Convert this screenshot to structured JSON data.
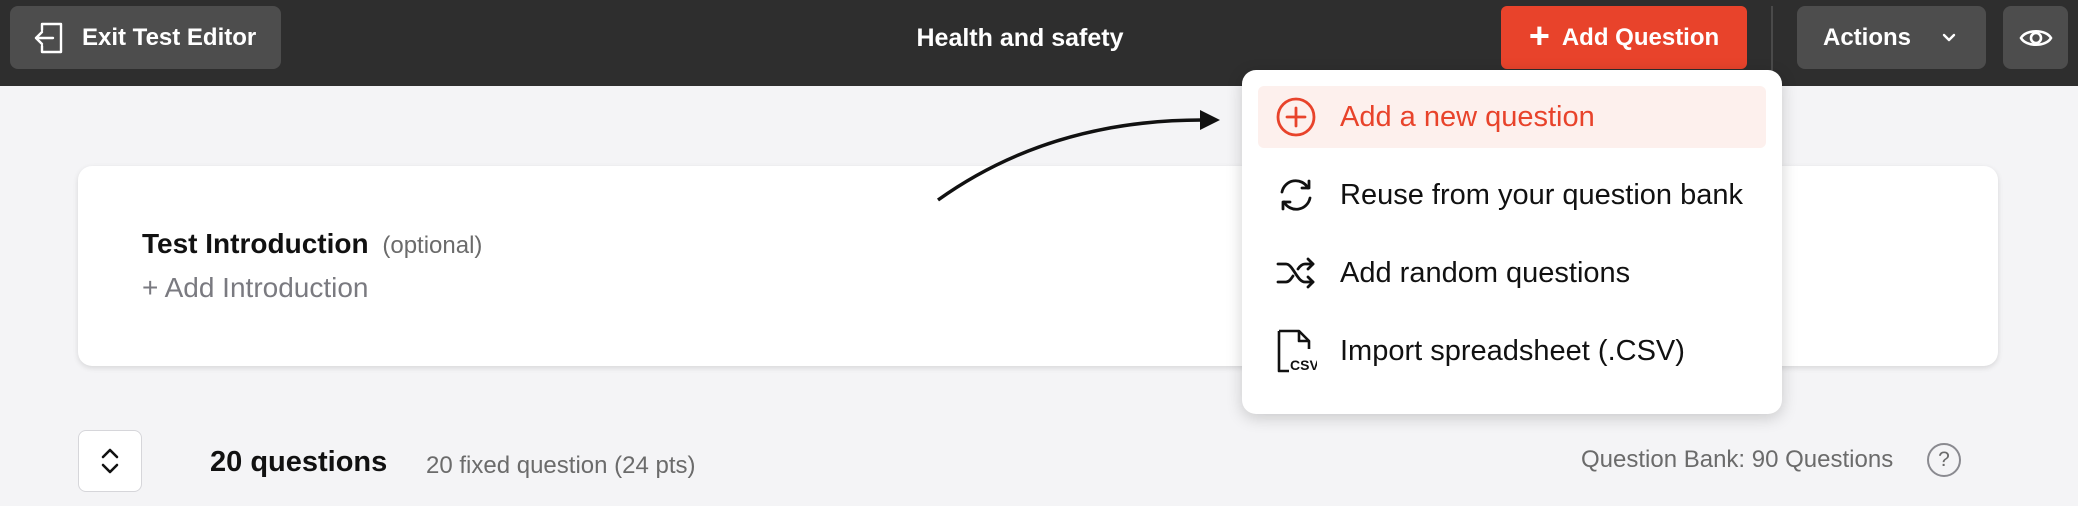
{
  "header": {
    "exit_label": "Exit Test Editor",
    "title": "Health and safety",
    "add_question_label": "Add Question",
    "actions_label": "Actions"
  },
  "icons": {
    "exit": "exit-icon",
    "plus": "plus-icon",
    "chevron": "chevron-down-icon",
    "eye": "eye-icon",
    "sort": "sort-icon",
    "help": "help-icon"
  },
  "colors": {
    "accent": "#e8432b",
    "topbar": "#2e2e2e",
    "active_bg": "#fdf0ed"
  },
  "intro": {
    "title": "Test Introduction",
    "optional": "(optional)",
    "add_label": "+ Add Introduction"
  },
  "questions": {
    "count_label": "20 questions",
    "fixed_label": "20 fixed question (24 pts)",
    "bank_label": "Question Bank: 90 Questions",
    "help_glyph": "?"
  },
  "menu": {
    "items": [
      {
        "label": "Add a new question",
        "icon": "plus-circle-icon",
        "active": true
      },
      {
        "label": "Reuse from your question bank",
        "icon": "refresh-icon",
        "active": false
      },
      {
        "label": "Add random questions",
        "icon": "shuffle-icon",
        "active": false
      },
      {
        "label": "Import spreadsheet (.CSV)",
        "icon": "csv-file-icon",
        "active": false
      }
    ]
  },
  "plus_glyph": "+"
}
